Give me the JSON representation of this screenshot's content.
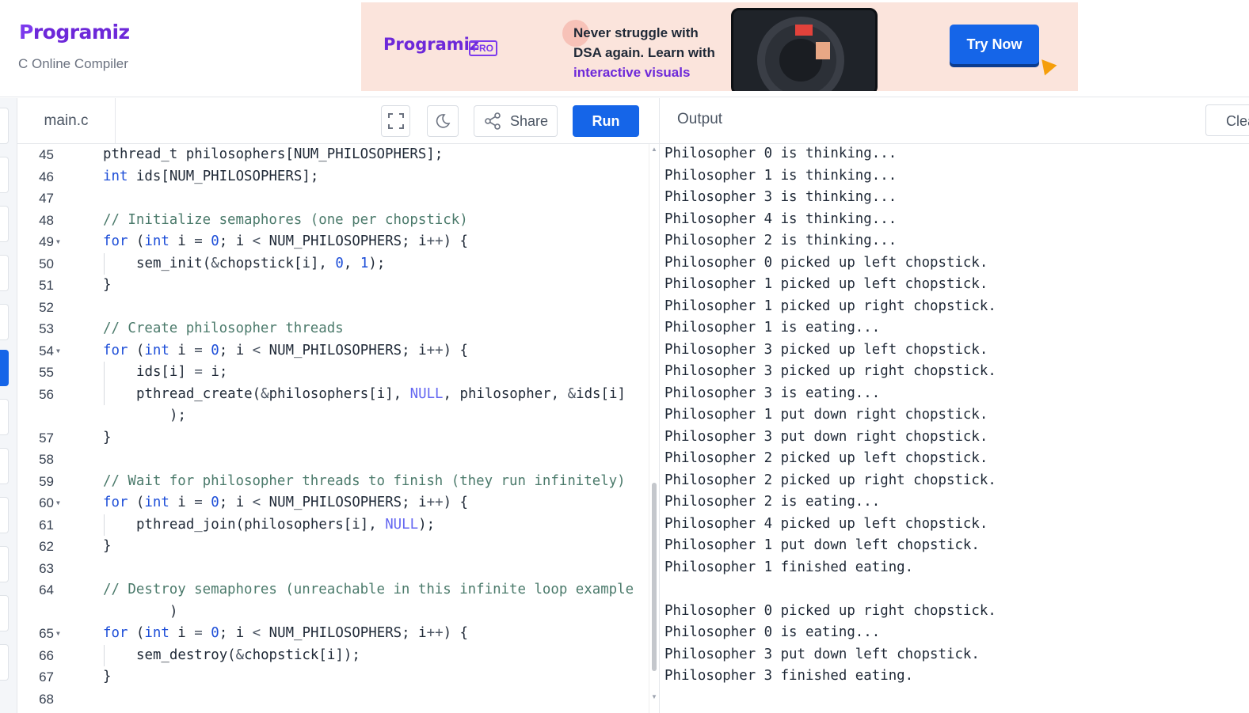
{
  "header": {
    "logo_text": "Programiz",
    "subtitle": "C Online Compiler"
  },
  "ad": {
    "logo_text": "Programiz",
    "badge": "PRO",
    "line1": "Never struggle with",
    "line2": "DSA again. Learn with",
    "line3": "interactive visuals",
    "cta": "Try Now"
  },
  "editor": {
    "file_tab": "main.c",
    "share_label": "Share",
    "run_label": "Run",
    "lines": [
      {
        "n": "45",
        "fold": false,
        "code": "pthread_t philosophers[NUM_PHILOSOPHERS];"
      },
      {
        "n": "46",
        "fold": false,
        "code": "int ids[NUM_PHILOSOPHERS];"
      },
      {
        "n": "47",
        "fold": false,
        "code": ""
      },
      {
        "n": "48",
        "fold": false,
        "code": "// Initialize semaphores (one per chopstick)"
      },
      {
        "n": "49",
        "fold": true,
        "code": "for (int i = 0; i < NUM_PHILOSOPHERS; i++) {"
      },
      {
        "n": "50",
        "fold": false,
        "code": "    sem_init(&chopstick[i], 0, 1);"
      },
      {
        "n": "51",
        "fold": false,
        "code": "}"
      },
      {
        "n": "52",
        "fold": false,
        "code": ""
      },
      {
        "n": "53",
        "fold": false,
        "code": "// Create philosopher threads"
      },
      {
        "n": "54",
        "fold": true,
        "code": "for (int i = 0; i < NUM_PHILOSOPHERS; i++) {"
      },
      {
        "n": "55",
        "fold": false,
        "code": "    ids[i] = i;"
      },
      {
        "n": "56",
        "fold": false,
        "code": "    pthread_create(&philosophers[i], NULL, philosopher, &ids[i]"
      },
      {
        "n": "",
        "fold": false,
        "code": ");"
      },
      {
        "n": "57",
        "fold": false,
        "code": "}"
      },
      {
        "n": "58",
        "fold": false,
        "code": ""
      },
      {
        "n": "59",
        "fold": false,
        "code": "// Wait for philosopher threads to finish (they run infinitely)"
      },
      {
        "n": "60",
        "fold": true,
        "code": "for (int i = 0; i < NUM_PHILOSOPHERS; i++) {"
      },
      {
        "n": "61",
        "fold": false,
        "code": "    pthread_join(philosophers[i], NULL);"
      },
      {
        "n": "62",
        "fold": false,
        "code": "}"
      },
      {
        "n": "63",
        "fold": false,
        "code": ""
      },
      {
        "n": "64",
        "fold": false,
        "code": "// Destroy semaphores (unreachable in this infinite loop example"
      },
      {
        "n": "",
        "fold": false,
        "code": ")"
      },
      {
        "n": "65",
        "fold": true,
        "code": "for (int i = 0; i < NUM_PHILOSOPHERS; i++) {"
      },
      {
        "n": "66",
        "fold": false,
        "code": "    sem_destroy(&chopstick[i]);"
      },
      {
        "n": "67",
        "fold": false,
        "code": "}"
      },
      {
        "n": "68",
        "fold": false,
        "code": ""
      }
    ]
  },
  "output": {
    "title": "Output",
    "clear_label": "Clear",
    "lines": [
      "Philosopher 0 is thinking...",
      "Philosopher 1 is thinking...",
      "Philosopher 3 is thinking...",
      "Philosopher 4 is thinking...",
      "Philosopher 2 is thinking...",
      "Philosopher 0 picked up left chopstick.",
      "Philosopher 1 picked up left chopstick.",
      "Philosopher 1 picked up right chopstick.",
      "Philosopher 1 is eating...",
      "Philosopher 3 picked up left chopstick.",
      "Philosopher 3 picked up right chopstick.",
      "Philosopher 3 is eating...",
      "Philosopher 1 put down right chopstick.",
      "Philosopher 3 put down right chopstick.",
      "Philosopher 2 picked up left chopstick.",
      "Philosopher 2 picked up right chopstick.",
      "Philosopher 2 is eating...",
      "Philosopher 4 picked up left chopstick.",
      "Philosopher 1 put down left chopstick.",
      "Philosopher 1 finished eating.",
      "",
      "Philosopher 0 picked up right chopstick.",
      "Philosopher 0 is eating...",
      "Philosopher 3 put down left chopstick.",
      "Philosopher 3 finished eating."
    ]
  },
  "colors": {
    "brand_purple": "#6d28d9",
    "run_blue": "#1565e8",
    "keyword": "#1d4ed8",
    "comment": "#4b7a6b"
  }
}
